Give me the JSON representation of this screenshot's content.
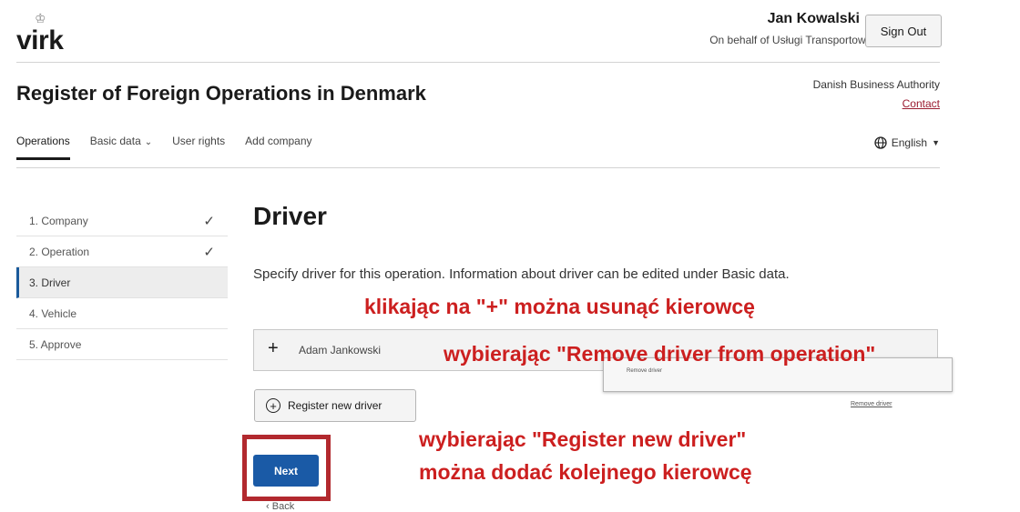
{
  "header": {
    "logo_text": "virk",
    "user_name": "Jan Kowalski",
    "on_behalf": "On behalf of Usługi Transportowe Jan Kowals...",
    "sign_out": "Sign Out",
    "app_title": "Register of Foreign Operations in Denmark",
    "authority": "Danish Business Authority",
    "contact": "Contact"
  },
  "nav": {
    "items": [
      {
        "label": "Operations",
        "active": true
      },
      {
        "label": "Basic data",
        "dropdown": true
      },
      {
        "label": "User rights"
      },
      {
        "label": "Add company"
      }
    ],
    "language": "English"
  },
  "steps": [
    {
      "label": "1. Company",
      "done": true
    },
    {
      "label": "2. Operation",
      "done": true
    },
    {
      "label": "3. Driver",
      "active": true
    },
    {
      "label": "4. Vehicle"
    },
    {
      "label": "5. Approve"
    }
  ],
  "main": {
    "heading": "Driver",
    "description": "Specify driver for this operation. Information about driver can be edited under Basic data.",
    "driver_item": {
      "expand_symbol": "+",
      "name": "Adam Jankowski"
    },
    "popup_text": "Remove driver",
    "register_button": "Register new driver",
    "next_button": "Next",
    "back_link": "Back"
  },
  "annotations": {
    "line1": "klikając na \"+\" można usunąć kierowcę",
    "line2": "wybierając \"Remove driver from operation\"",
    "line3": "wybierając \"Register new driver\"",
    "line4": "można dodać kolejnego kierowcę"
  },
  "colors": {
    "annotation_red": "#cc1f1f",
    "primary_button": "#1a5aa6",
    "contact_link": "#9b1b30",
    "highlight_frame": "#b2292e"
  }
}
